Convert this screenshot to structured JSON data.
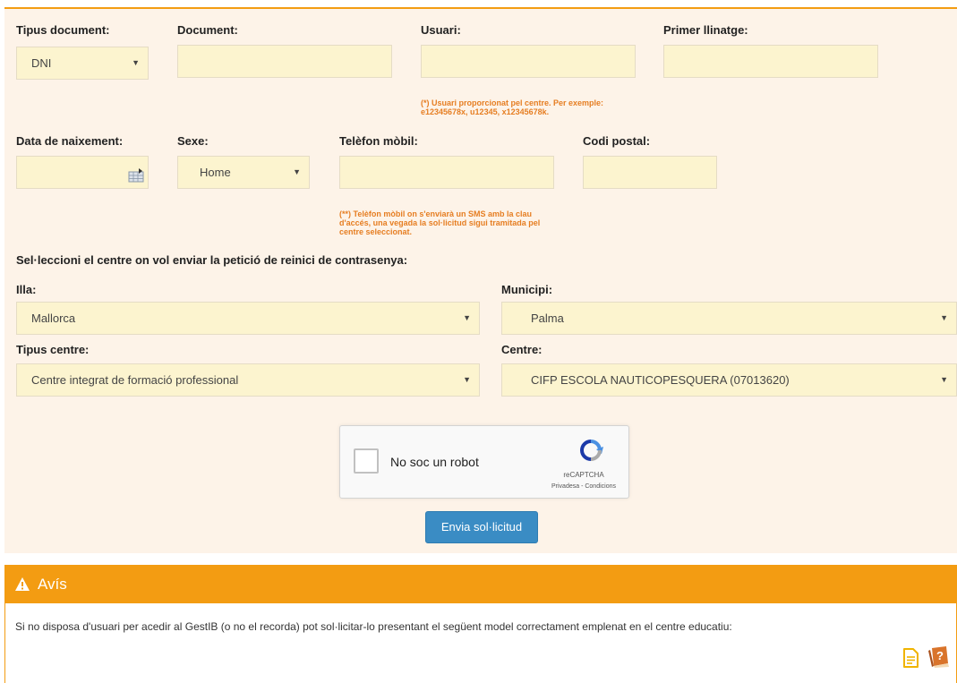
{
  "form": {
    "doc_type_label": "Tipus document:",
    "doc_type_value": "DNI",
    "document_label": "Document:",
    "document_value": "",
    "user_label": "Usuari:",
    "user_value": "",
    "user_note": "(*) Usuari proporcionat pel centre. Per exemple: e12345678x, u12345, x12345678k.",
    "surname_label": "Primer llinatge:",
    "surname_value": "",
    "birthdate_label": "Data de naixement:",
    "birthdate_value": "",
    "sex_label": "Sexe:",
    "sex_value": "Home",
    "phone_label": "Telèfon mòbil:",
    "phone_value": "",
    "phone_note": "(**) Telèfon mòbil on s'enviarà un SMS amb la clau d'accés, una vegada la sol·licitud sigui tramitada pel centre seleccionat.",
    "postal_label": "Codi postal:",
    "postal_value": "",
    "center_prompt": "Sel·leccioni el centre on vol enviar la petició de reinici de contrasenya:",
    "island_label": "Illa:",
    "island_value": "Mallorca",
    "municipality_label": "Municipi:",
    "municipality_value": "Palma",
    "center_type_label": "Tipus centre:",
    "center_type_value": "Centre integrat de formació professional",
    "center_label": "Centre:",
    "center_value": "CIFP ESCOLA NAUTICOPESQUERA (07013620)",
    "submit_label": "Envia sol·licitud"
  },
  "captcha": {
    "label": "No soc un robot",
    "brand": "reCAPTCHA",
    "links": "Privadesa - Condicions"
  },
  "notice": {
    "title": "Avís",
    "text": "Si no disposa d'usuari per acedir al GestIB (o no el recorda) pot sol·licitar-lo presentant el següent model correctament emplenat en el centre educatiu:"
  },
  "icons": {
    "caret": "▼",
    "warning": "warning-icon",
    "document": "document-icon",
    "help": "help-book-icon",
    "calendar": "calendar-icon"
  },
  "colors": {
    "accent": "#f39c12",
    "panel_bg": "#fdf3e8",
    "field_bg": "#fcf4cf",
    "note": "#e67e22",
    "button": "#3a8cc4"
  }
}
